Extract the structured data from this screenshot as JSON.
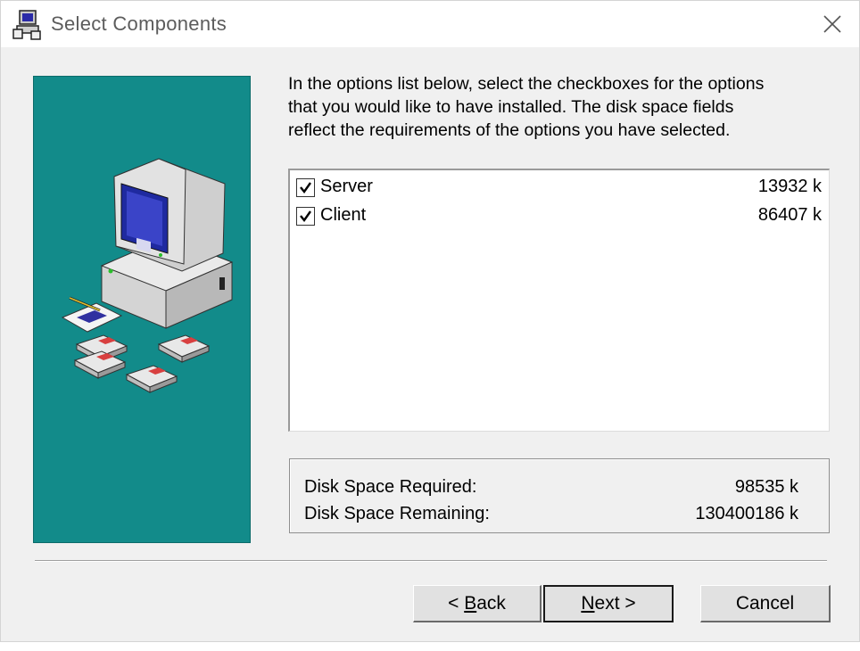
{
  "window": {
    "title": "Select Components",
    "icon": "setup-computer-icon",
    "close_icon": "close-icon"
  },
  "intro": {
    "line1": "In the options list below, select the checkboxes for the options",
    "line2": "that you would like to have installed.  The disk space fields",
    "line3": "reflect the requirements of the options you have selected."
  },
  "components": [
    {
      "label": "Server",
      "size": "13932 k",
      "checked": true
    },
    {
      "label": "Client",
      "size": "86407 k",
      "checked": true
    }
  ],
  "disk": {
    "required_label": "Disk Space Required:",
    "required_value": "98535 k",
    "remaining_label": "Disk Space Remaining:",
    "remaining_value": "130400186 k"
  },
  "buttons": {
    "back_prefix": "< ",
    "back_mnemonic": "B",
    "back_rest": "ack",
    "next_mnemonic": "N",
    "next_rest": "ext >",
    "cancel": "Cancel"
  },
  "colors": {
    "banner": "#128b8a",
    "dialog": "#f0f0f0"
  }
}
